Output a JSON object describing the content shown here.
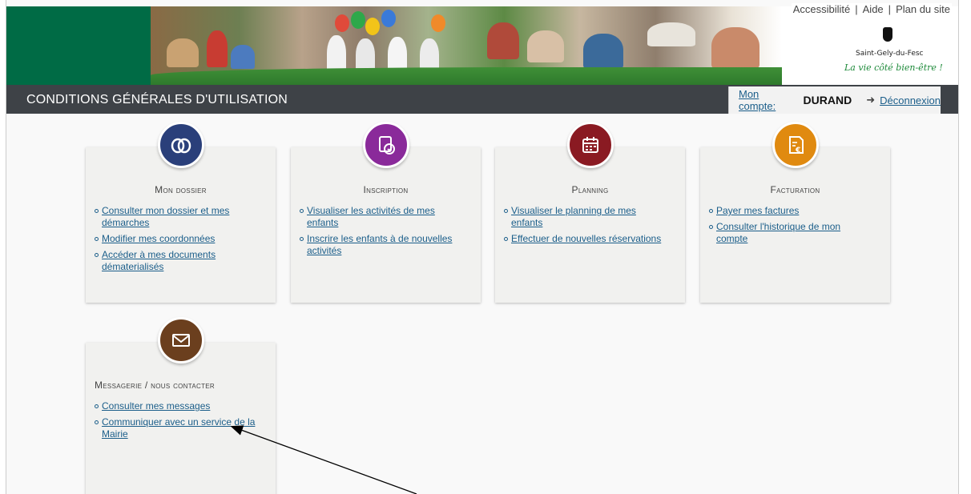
{
  "header": {
    "links": [
      "Accessibilité",
      "Aide",
      "Plan du site"
    ],
    "town": "Saint-Gely-du-Fesc",
    "slogan": "La vie côté bien-être !"
  },
  "title_bar": {
    "title": "CONDITIONS GÉNÉRALES D'UTILISATION",
    "account_label": "Mon compte:",
    "account_name": "DURAND",
    "logout_label": "Déconnexion"
  },
  "cards": [
    {
      "title": "Mon dossier",
      "icon": "dossier-icon",
      "color": "#2a3f7a",
      "links": [
        "Consulter mon dossier et mes démarches",
        "Modifier mes coordonnées",
        "Accéder à mes documents dématerialisés"
      ]
    },
    {
      "title": "Inscription",
      "icon": "inscription-icon",
      "color": "#8a2a9a",
      "links": [
        "Visualiser les activités de mes enfants",
        "Inscrire les enfants à de nouvelles activités"
      ]
    },
    {
      "title": "Planning",
      "icon": "calendar-icon",
      "color": "#8a1a22",
      "links": [
        "Visualiser le planning de mes enfants",
        "Effectuer de nouvelles réservations"
      ]
    },
    {
      "title": "Facturation",
      "icon": "invoice-icon",
      "color": "#e08a10",
      "links": [
        "Payer mes factures",
        "Consulter l'historique de mon compte"
      ]
    },
    {
      "title": "Messagerie / nous contacter",
      "icon": "envelope-icon",
      "color": "#6b3f1e",
      "links": [
        "Consulter mes messages",
        "Communiquer avec un service de la Mairie"
      ]
    }
  ]
}
